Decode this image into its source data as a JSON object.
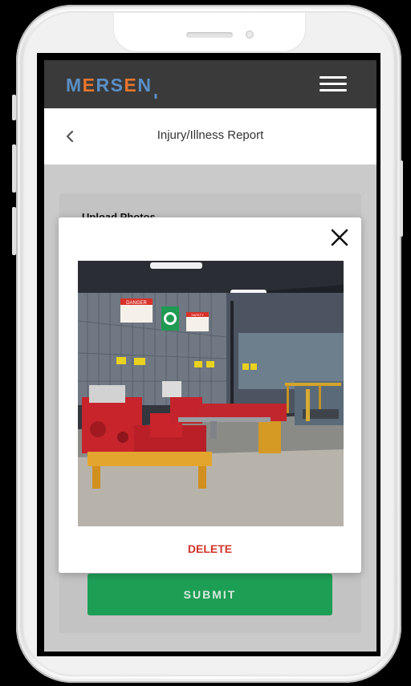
{
  "app": {
    "brand": "MERSEN",
    "page_title": "Injury/Illness Report"
  },
  "form": {
    "section_heading": "Upload Photos",
    "submit_label": "SUBMIT"
  },
  "photo_modal": {
    "delete_label": "DELETE"
  },
  "photo_signs": {
    "sign_1": "DANGER",
    "sign_2": "SAFETY"
  },
  "colors": {
    "header_bg": "#3a3a3a",
    "logo_blue": "#5b8fc6",
    "logo_orange": "#e8762c",
    "submit_green": "#1d9e55",
    "delete_red": "#d3332a"
  },
  "icons": {
    "back": "chevron-left-icon",
    "menu": "hamburger-menu-icon",
    "close": "close-icon"
  }
}
